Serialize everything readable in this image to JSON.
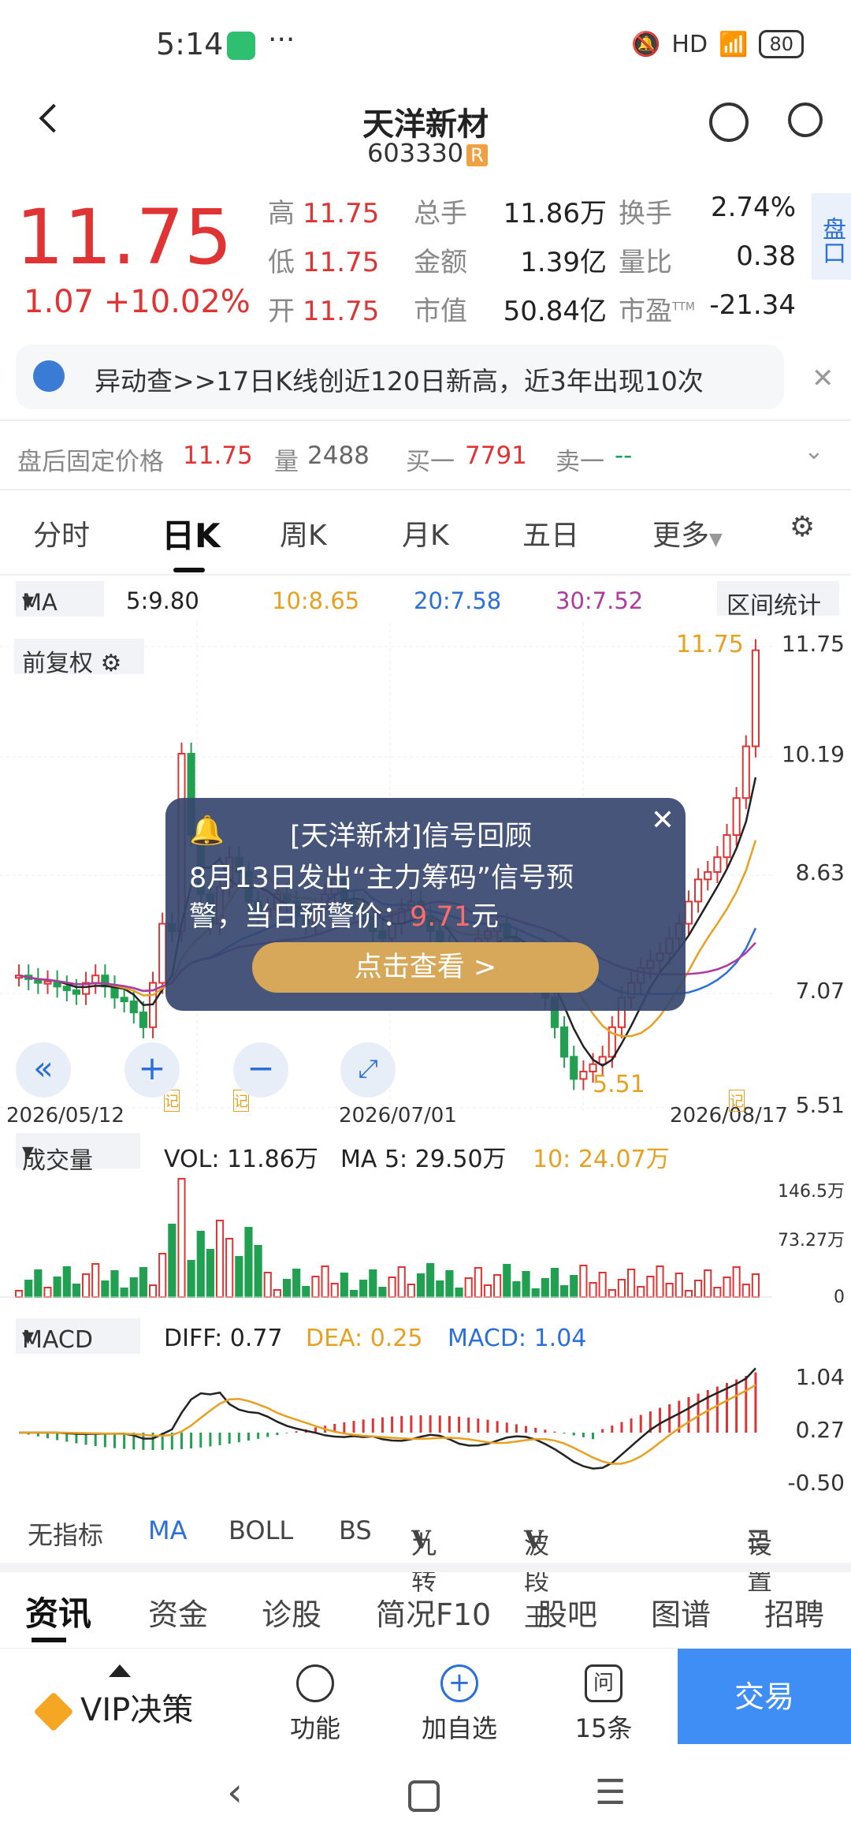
{
  "status_bar": {
    "time": "5:14",
    "signal": "HD",
    "battery": "80"
  },
  "header": {
    "title": "天洋新材",
    "code": "603330",
    "tag": "R"
  },
  "quote": {
    "price": "11.75",
    "change": "1.07  +10.02%",
    "high_label": "高",
    "high": "11.75",
    "low_label": "低",
    "low": "11.75",
    "open_label": "开",
    "open": "11.75",
    "vol_label": "总手",
    "vol": "11.86万",
    "amount_label": "金额",
    "amount": "1.39亿",
    "mcap_label": "市值",
    "mcap": "50.84亿",
    "turnover_label": "换手",
    "turnover": "2.74%",
    "vratio_label": "量比",
    "vratio": "0.38",
    "pe_label": "市盈",
    "pe_sup": "TTM",
    "pe": "-21.34",
    "pankou": "盘口"
  },
  "alert": {
    "text": "异动查>>17日K线创近120日新高，近3年出现10次"
  },
  "after_hours": {
    "label": "盘后固定价格",
    "price": "11.75",
    "vol_label": "量",
    "vol": "2488",
    "bid_label": "买一",
    "bid": "7791",
    "ask_label": "卖一",
    "ask": "--"
  },
  "kline_tabs": [
    "分时",
    "日K",
    "周K",
    "月K",
    "五日",
    "更多"
  ],
  "ma_bar": {
    "select": "MA",
    "ma5": "5:9.80",
    "ma10": "10:8.65",
    "ma20": "20:7.58",
    "ma30": "30:7.52",
    "stats": "区间统计"
  },
  "colors": {
    "up": "#e03434",
    "down": "#20a050",
    "ma5": "#222222",
    "ma10": "#e8a020",
    "ma20": "#2a6fdb",
    "ma30": "#b03aa0"
  },
  "kchart": {
    "adjust_label": "前复权",
    "y_ticks": [
      "11.75",
      "10.19",
      "8.63",
      "7.07",
      "5.51"
    ],
    "x_ticks": [
      "2026/05/12",
      "2026/07/01",
      "2026/08/17"
    ],
    "high_mark": "11.75",
    "low_mark": "5.51",
    "note_icon": "记"
  },
  "popup": {
    "title": "[天洋新材]信号回顾",
    "line2": "8月13日发出“主力筹码”信号预",
    "line3_prefix": "警，当日预警价：",
    "line3_price": "9.71",
    "line3_suffix": "元",
    "button": "点击查看 >"
  },
  "volume": {
    "select": "成交量",
    "vol": "VOL: 11.86万",
    "ma5": "MA 5: 29.50万",
    "ma10": "10: 24.07万",
    "y_ticks": [
      "146.5万",
      "73.27万",
      "0"
    ]
  },
  "macd": {
    "select": "MACD",
    "diff": "DIFF: 0.77",
    "dea": "DEA: 0.25",
    "macd": "MACD: 1.04",
    "y_ticks": [
      "1.04",
      "0.27",
      "-0.50"
    ]
  },
  "indicator_tabs": {
    "none": "无指标",
    "ma": "MA",
    "boll": "BOLL",
    "bs": "BS",
    "v1": "九转",
    "v2": "波段王",
    "v3": "追击",
    "settings": "设置"
  },
  "info_tabs": [
    "资讯",
    "资金",
    "诊股",
    "简况F10",
    "股吧",
    "图谱",
    "招聘"
  ],
  "bottom_bar": {
    "vip": "VIP决策",
    "func": "功能",
    "add": "加自选",
    "ask": "15条",
    "ask_icon": "问",
    "trade": "交易"
  }
}
